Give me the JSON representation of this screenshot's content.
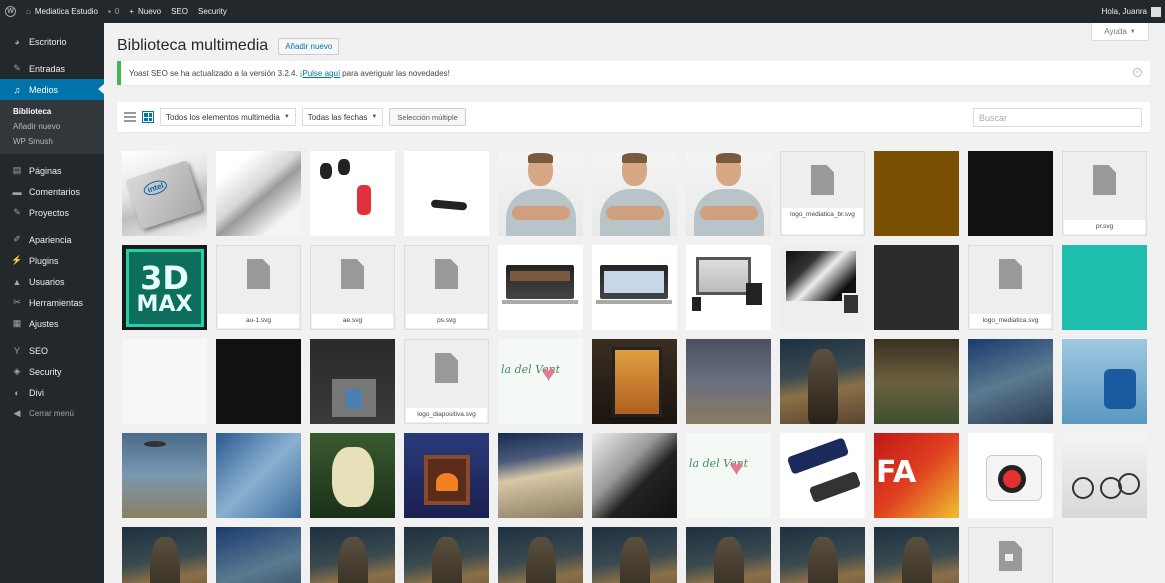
{
  "adminbar": {
    "site_name": "Mediatica Estudio",
    "comments_count": "0",
    "new_label": "Nuevo",
    "seo_label": "SEO",
    "security_label": "Security",
    "greeting": "Hola, Juanra"
  },
  "sidebar": {
    "items": [
      {
        "label": "Escritorio",
        "icon": "dashboard-icon"
      },
      {
        "label": "Entradas",
        "icon": "pin-icon"
      },
      {
        "label": "Medios",
        "icon": "media-icon"
      },
      {
        "label": "Páginas",
        "icon": "page-icon"
      },
      {
        "label": "Comentarios",
        "icon": "comment-icon"
      },
      {
        "label": "Proyectos",
        "icon": "pin-icon"
      },
      {
        "label": "Apariencia",
        "icon": "brush-icon"
      },
      {
        "label": "Plugins",
        "icon": "plug-icon"
      },
      {
        "label": "Usuarios",
        "icon": "user-icon"
      },
      {
        "label": "Herramientas",
        "icon": "wrench-icon"
      },
      {
        "label": "Ajustes",
        "icon": "settings-icon"
      },
      {
        "label": "SEO",
        "icon": "yoast-icon"
      },
      {
        "label": "Security",
        "icon": "shield-icon"
      },
      {
        "label": "Divi",
        "icon": "divi-icon"
      },
      {
        "label": "Cerrar menú",
        "icon": "collapse-icon"
      }
    ],
    "submenu": [
      "Biblioteca",
      "Añadir nuevo",
      "WP Smush"
    ]
  },
  "help_tab": {
    "label": "Ayuda"
  },
  "header": {
    "title": "Biblioteca multimedia",
    "add_new": "Añadir nuevo"
  },
  "notice": {
    "text_before": "Yoast SEO se ha actualizado a la versión 3.2.4.",
    "link": "¡Pulse aquí",
    "text_after": "para averiguar las novedades!"
  },
  "toolbar": {
    "filter_type": "Todos los elementos multimedia",
    "filter_date": "Todas las fechas",
    "bulk_select": "Selección múltiple",
    "search_placeholder": "Buscar"
  },
  "media": {
    "files": {
      "logo_mediatica_br": "logo_mediatica_br.svg",
      "pr": "pr.svg",
      "au1": "au-1.svg",
      "ae": "ae.svg",
      "ps": "ps.svg",
      "logo_mediatica": "logo_mediatica.svg",
      "logo_diapositiva": "logo_diapositiva.svg"
    }
  },
  "colors": {
    "accent": "#0073aa",
    "adminbar": "#23282d",
    "notice_success": "#46b450"
  }
}
